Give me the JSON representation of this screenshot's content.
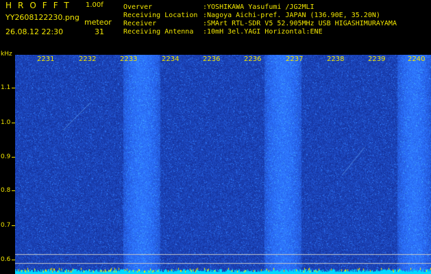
{
  "header": {
    "app_title": "HROFFT",
    "version": "1.00f",
    "filename": "YY2608122230.png",
    "mode": "meteor",
    "datetime": "26.08.12 22:30",
    "count": "31"
  },
  "info": [
    {
      "label": "Overver",
      "value": ":YOSHIKAWA Yasufumi /JG2MLI"
    },
    {
      "label": "Receiving Location",
      "value": ":Nagoya Aichi-pref. JAPAN (136.90E, 35.20N)"
    },
    {
      "label": "Receiver",
      "value": ":SMArt RTL-SDR V5 52.905MHz USB HIGASHIMURAYAMA"
    },
    {
      "label": "Receiving Antenna",
      "value": ":10mH 3el.YAGI Horizontal:ENE"
    }
  ],
  "y_axis": {
    "unit": "kHz",
    "labels": [
      "1.1",
      "1.0",
      "0.9",
      "0.8",
      "0.7",
      "0.6"
    ]
  },
  "x_axis": {
    "labels": [
      "2231",
      "2232",
      "2233",
      "2234",
      "2236",
      "2236",
      "2237",
      "2238",
      "2239",
      "2240"
    ]
  },
  "colors": {
    "text": "#f2e600",
    "background": "#000000",
    "spectrum_base": "#0a1a8c",
    "spectrum_hot": "#3a8cff",
    "floor_noise": "#00d8ff",
    "floor_yellow": "#f2e600"
  },
  "chart_data": {
    "type": "heatmap",
    "title": "",
    "xlabel": "",
    "ylabel": "kHz",
    "x_ticks": [
      "2231",
      "2232",
      "2233",
      "2234",
      "2236",
      "2236",
      "2237",
      "2238",
      "2239",
      "2240"
    ],
    "y_ticks": [
      "1.1",
      "1.0",
      "0.9",
      "0.8",
      "0.7",
      "0.6"
    ],
    "ylim": [
      0.55,
      1.2
    ]
  }
}
